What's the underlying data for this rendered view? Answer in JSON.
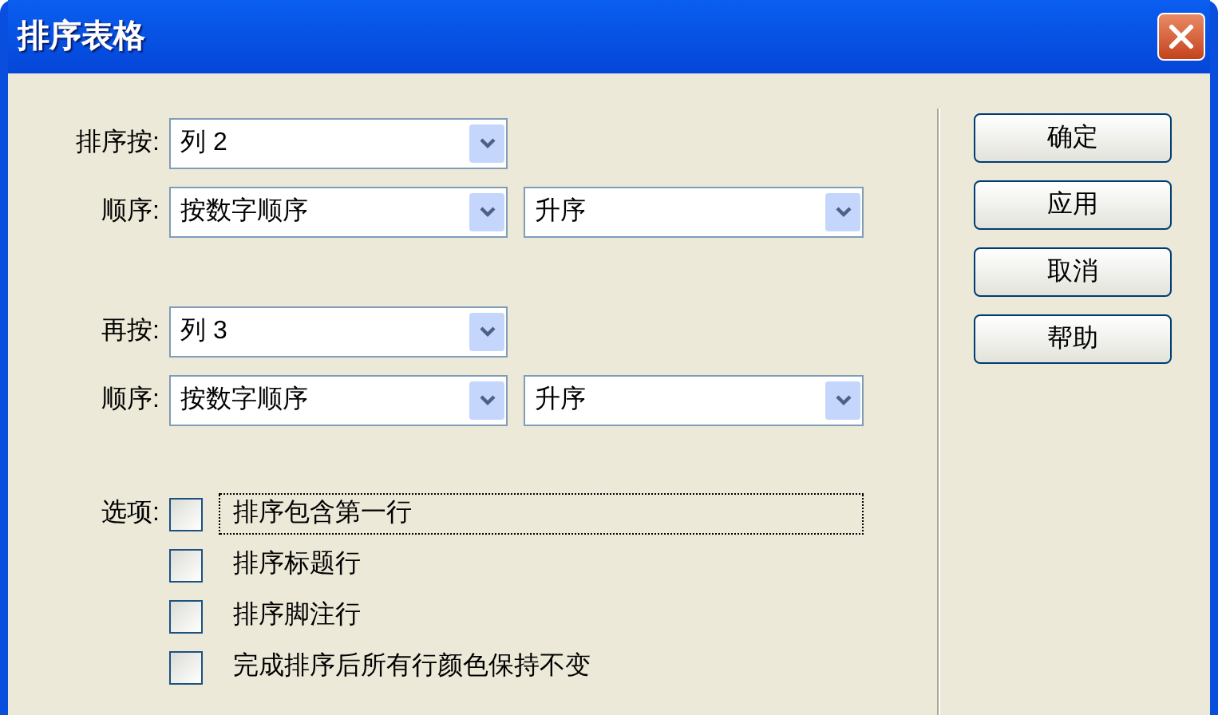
{
  "window": {
    "title": "排序表格"
  },
  "sort_keys": [
    {
      "label": "排序按:",
      "column": "列 2",
      "order_label": "顺序:",
      "order_type": "按数字顺序",
      "direction": "升序"
    },
    {
      "label": "再按:",
      "column": "列 3",
      "order_label": "顺序:",
      "order_type": "按数字顺序",
      "direction": "升序"
    }
  ],
  "options": {
    "label": "选项:",
    "items": [
      {
        "label": "排序包含第一行",
        "checked": false,
        "focused": true
      },
      {
        "label": "排序标题行",
        "checked": false,
        "focused": false
      },
      {
        "label": "排序脚注行",
        "checked": false,
        "focused": false
      },
      {
        "label": "完成排序后所有行颜色保持不变",
        "checked": false,
        "focused": false
      }
    ]
  },
  "buttons": [
    "确定",
    "应用",
    "取消",
    "帮助"
  ]
}
